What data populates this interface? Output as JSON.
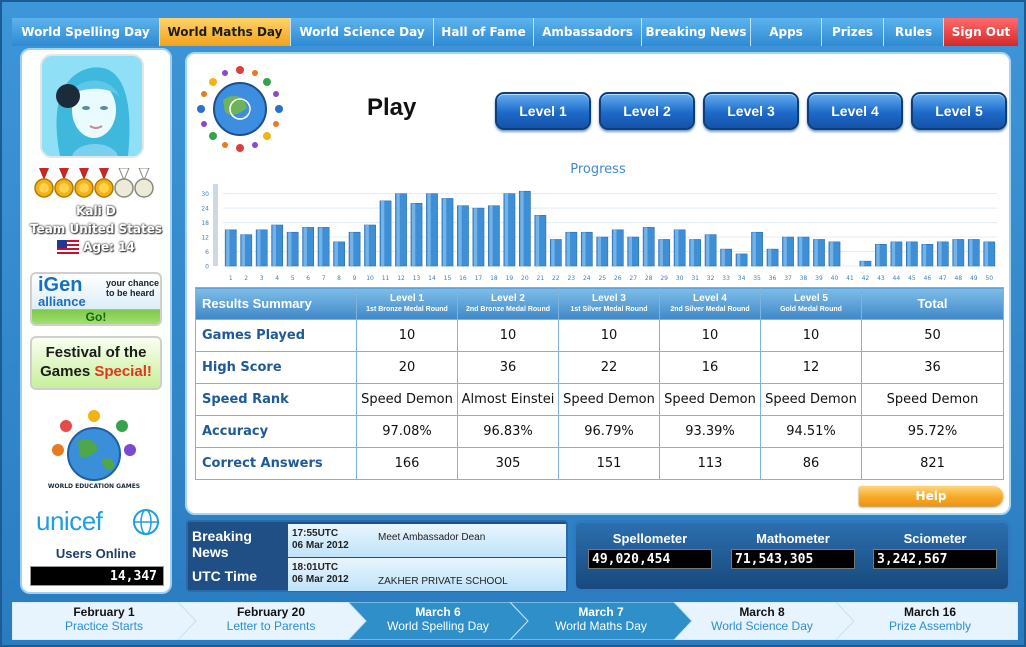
{
  "nav": {
    "tabs": [
      {
        "label": "World Spelling Day"
      },
      {
        "label": "World Maths Day",
        "active": true
      },
      {
        "label": "World Science Day"
      },
      {
        "label": "Hall of Fame"
      },
      {
        "label": "Ambassadors"
      },
      {
        "label": "Breaking News"
      },
      {
        "label": "Apps"
      },
      {
        "label": "Prizes"
      },
      {
        "label": "Rules"
      },
      {
        "label": "Sign Out"
      }
    ]
  },
  "user": {
    "name": "Kali D",
    "team": "Team United States",
    "age": "Age: 14",
    "medals_earned": 4,
    "medals_total": 6
  },
  "sidebar": {
    "igen_title": "iGen",
    "igen_sub": "alliance",
    "igen_tag": "your chance to be heard",
    "igen_go": "Go!",
    "festival_line1": "Festival of the",
    "festival_line2a": "Games ",
    "festival_line2b": "Special!",
    "weg_text": "WORLD EDUCATION GAMES",
    "unicef": "unicef",
    "users_online_label": "Users Online",
    "users_online_count": "14,347"
  },
  "play": {
    "title": "Play",
    "levels": [
      "Level 1",
      "Level 2",
      "Level 3",
      "Level 4",
      "Level 5"
    ],
    "help_label": "Help"
  },
  "chart_data": {
    "type": "bar",
    "title": "Progress",
    "y_ticks": [
      0,
      6,
      12,
      18,
      24,
      30
    ],
    "ylim": [
      0,
      34
    ],
    "categories": [
      "1",
      "2",
      "3",
      "4",
      "5",
      "6",
      "7",
      "8",
      "9",
      "10",
      "11",
      "12",
      "13",
      "14",
      "15",
      "16",
      "17",
      "18",
      "19",
      "20",
      "21",
      "22",
      "23",
      "24",
      "25",
      "26",
      "27",
      "28",
      "29",
      "30",
      "31",
      "32",
      "33",
      "34",
      "35",
      "36",
      "37",
      "38",
      "39",
      "40",
      "41",
      "42",
      "43",
      "44",
      "45",
      "46",
      "47",
      "48",
      "49",
      "50"
    ],
    "values": [
      15,
      13,
      15,
      17,
      14,
      16,
      16,
      10,
      14,
      17,
      27,
      30,
      26,
      30,
      28,
      25,
      24,
      25,
      30,
      31,
      21,
      11,
      14,
      14,
      12,
      15,
      12,
      16,
      11,
      15,
      11,
      13,
      7,
      5,
      14,
      7,
      12,
      12,
      11,
      10,
      0,
      2,
      9,
      10,
      10,
      9,
      10,
      11,
      11,
      10
    ],
    "color": "#3e8fd6"
  },
  "results": {
    "title": "Results Summary",
    "columns": [
      {
        "level": "Level 1",
        "sub": "1st Bronze Medal Round"
      },
      {
        "level": "Level 2",
        "sub": "2nd Bronze Medal Round"
      },
      {
        "level": "Level 3",
        "sub": "1st Silver Medal Round"
      },
      {
        "level": "Level 4",
        "sub": "2nd Silver Medal Round"
      },
      {
        "level": "Level 5",
        "sub": "Gold Medal Round"
      }
    ],
    "total_label": "Total",
    "rows": [
      {
        "label": "Games Played",
        "values": [
          "10",
          "10",
          "10",
          "10",
          "10",
          "50"
        ]
      },
      {
        "label": "High Score",
        "values": [
          "20",
          "36",
          "22",
          "16",
          "12",
          "36"
        ]
      },
      {
        "label": "Speed Rank",
        "values": [
          "Speed Demon",
          "Almost Einstei",
          "Speed Demon",
          "Speed Demon",
          "Speed Demon",
          "Speed Demon"
        ]
      },
      {
        "label": "Accuracy",
        "values": [
          "97.08%",
          "96.83%",
          "96.79%",
          "93.39%",
          "94.51%",
          "95.72%"
        ]
      },
      {
        "label": "Correct Answers",
        "values": [
          "166",
          "305",
          "151",
          "113",
          "86",
          "821"
        ]
      }
    ]
  },
  "news": {
    "breaking_label_1": "Breaking",
    "breaking_label_2": "News",
    "utc_label": "UTC Time",
    "item1": {
      "time": "17:55UTC",
      "date": "06 Mar 2012",
      "text": "Meet Ambassador Dean"
    },
    "item2": {
      "time": "18:01UTC",
      "date": "06 Mar 2012",
      "text": "ZAKHER PRIVATE SCHOOL"
    }
  },
  "meters": [
    {
      "label": "Spellometer",
      "value": "49,020,454"
    },
    {
      "label": "Mathometer",
      "value": "71,543,305"
    },
    {
      "label": "Sciometer",
      "value": "3,242,567"
    }
  ],
  "timeline": [
    {
      "date": "February 1",
      "event": "Practice Starts"
    },
    {
      "date": "February 20",
      "event": "Letter to Parents"
    },
    {
      "date": "March 6",
      "event": "World Spelling Day",
      "dark": true
    },
    {
      "date": "March 7",
      "event": "World Maths Day",
      "dark": true
    },
    {
      "date": "March 8",
      "event": "World Science Day"
    },
    {
      "date": "March 16",
      "event": "Prize Assembly"
    }
  ],
  "colors": {
    "nav_blue": "#2f8ad3",
    "nav_active": "#f4a21b",
    "sign_out": "#d42a2a",
    "bar": "#3e8fd6",
    "help": "#f5a623"
  }
}
